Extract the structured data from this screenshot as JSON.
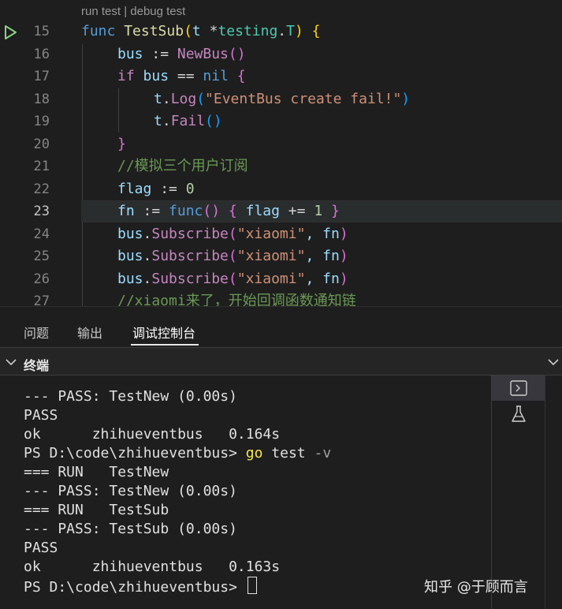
{
  "editor": {
    "codelens": "run test | debug test",
    "lines": [
      {
        "n": "15"
      },
      {
        "n": "16"
      },
      {
        "n": "17"
      },
      {
        "n": "18"
      },
      {
        "n": "19"
      },
      {
        "n": "20"
      },
      {
        "n": "21"
      },
      {
        "n": "22"
      },
      {
        "n": "23"
      },
      {
        "n": "24"
      },
      {
        "n": "25"
      },
      {
        "n": "26"
      },
      {
        "n": "27"
      }
    ],
    "code": {
      "l15": {
        "func": "func",
        "name": "TestSub",
        "open": "(",
        "param": "t",
        "star": " *",
        "pkg": "testing",
        "dot": ".",
        "type": "T",
        "close": ")",
        "brace": " {"
      },
      "l16": {
        "var": "bus",
        "op": " := ",
        "fn": "NewBus",
        "parens": "()"
      },
      "l17": {
        "kw": "if",
        "var": " bus ",
        "op": "== ",
        "nil": "nil",
        "brace": " {"
      },
      "l18": {
        "var": "t",
        "dot": ".",
        "fn": "Log",
        "open": "(",
        "str": "\"EventBus create fail!\"",
        "close": ")"
      },
      "l19": {
        "var": "t",
        "dot": ".",
        "fn": "Fail",
        "parens": "()"
      },
      "l20": {
        "brace": "}"
      },
      "l21": {
        "comment": "//模拟三个用户订阅"
      },
      "l22": {
        "var": "flag",
        "op": " := ",
        "num": "0"
      },
      "l23": {
        "var": "fn",
        "op": " := ",
        "func": "func",
        "parens": "()",
        "ob": " { ",
        "v2": "flag ",
        "op2": "+= ",
        "num": "1",
        "cb": " }"
      },
      "l24": {
        "var": "bus",
        "dot": ".",
        "fn": "Subscribe",
        "open": "(",
        "str": "\"xiaomi\"",
        "rest": ", fn",
        "close": ")"
      },
      "l25": {
        "var": "bus",
        "dot": ".",
        "fn": "Subscribe",
        "open": "(",
        "str": "\"xiaomi\"",
        "rest": ", fn",
        "close": ")"
      },
      "l26": {
        "var": "bus",
        "dot": ".",
        "fn": "Subscribe",
        "open": "(",
        "str": "\"xiaomi\"",
        "rest": ", fn",
        "close": ")"
      },
      "l27": {
        "comment": "//xiaomi来了，开始回调函数通知链"
      }
    }
  },
  "panel": {
    "tabs": [
      {
        "label": "问题"
      },
      {
        "label": "输出"
      },
      {
        "label": "调试控制台"
      }
    ],
    "active_tab": "调试控制台",
    "section_title": "终端"
  },
  "terminal": {
    "lines": [
      "--- PASS: TestNew (0.00s)",
      "PASS",
      "ok      zhihueventbus   0.164s",
      "PS D:\\code\\zhihueventbus> ",
      "=== RUN   TestNew",
      "--- PASS: TestNew (0.00s)",
      "=== RUN   TestSub",
      "--- PASS: TestSub (0.00s)",
      "PASS",
      "ok      zhihueventbus   0.163s",
      "PS D:\\code\\zhihueventbus> "
    ],
    "cmd_go": "go",
    "cmd_test": " test ",
    "cmd_flag": "-v",
    "side_icons": [
      "terminal-icon",
      "flask-icon"
    ]
  },
  "watermark": "知乎 @于顾而言",
  "colors": {
    "background": "#1e1e1e",
    "keyword": "#569cd6",
    "function": "#dcdcaa",
    "string": "#ce9178",
    "comment": "#6a9955",
    "variable": "#9cdcfe",
    "run_glyph": "#89d185"
  }
}
